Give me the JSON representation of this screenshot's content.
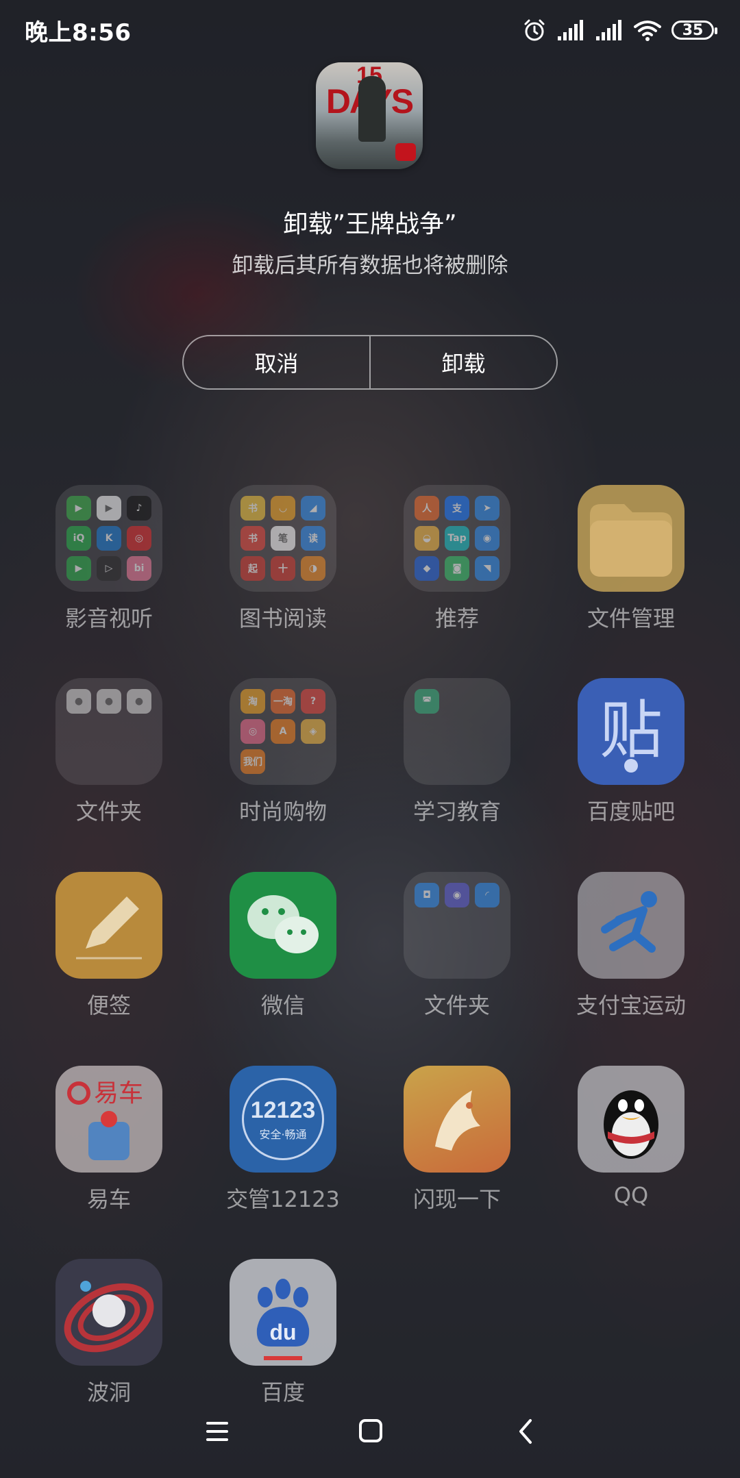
{
  "status_bar": {
    "time": "晚上8:56",
    "battery": "35",
    "icons": [
      "alarm-icon",
      "signal-icon-sim1",
      "signal-icon-sim2",
      "wifi-icon",
      "battery-icon"
    ]
  },
  "dialog": {
    "app_icon_text_top": "15",
    "app_icon_text": "DAYS",
    "title": "卸载”王牌战争”",
    "subtitle": "卸载后其所有数据也将被删除",
    "cancel_label": "取消",
    "uninstall_label": "卸载"
  },
  "apps": [
    {
      "label": "影音视听",
      "type": "folder",
      "minis": [
        {
          "icon": "play-store-icon",
          "color": "#3bb34a",
          "text": "▶"
        },
        {
          "icon": "video-icon",
          "color": "#ffffff",
          "text": "▶"
        },
        {
          "icon": "douyin-icon",
          "color": "#111111",
          "text": "♪"
        },
        {
          "icon": "iqiyi-icon",
          "color": "#27b34a",
          "text": "iQ"
        },
        {
          "icon": "kugou-icon",
          "color": "#1a7bd6",
          "text": "K"
        },
        {
          "icon": "netease-music-icon",
          "color": "#e02a2a",
          "text": "◎"
        },
        {
          "icon": "player-icon",
          "color": "#2bb04a",
          "text": "▶"
        },
        {
          "icon": "tencent-video-icon",
          "color": "#2b2b2b",
          "text": "▷"
        },
        {
          "icon": "bilibili-icon",
          "color": "#f07a9b",
          "text": "bi"
        }
      ]
    },
    {
      "label": "图书阅读",
      "type": "folder",
      "minis": [
        {
          "icon": "novel-icon",
          "color": "#f3c53b",
          "text": "书"
        },
        {
          "icon": "reader-icon",
          "color": "#f5a623",
          "text": "◡"
        },
        {
          "icon": "read-icon",
          "color": "#2d8cf0",
          "text": "◢"
        },
        {
          "icon": "book-icon",
          "color": "#e8453c",
          "text": "书"
        },
        {
          "icon": "pen-icon",
          "color": "#ffffff",
          "text": "笔"
        },
        {
          "icon": "qq-read-icon",
          "color": "#2d8cf0",
          "text": "读"
        },
        {
          "icon": "qidian-icon",
          "color": "#d33a31",
          "text": "起"
        },
        {
          "icon": "text-icon",
          "color": "#d33a31",
          "text": "十"
        },
        {
          "icon": "audio-book-icon",
          "color": "#f08a24",
          "text": "◑"
        }
      ]
    },
    {
      "label": "推荐",
      "type": "folder",
      "minis": [
        {
          "icon": "sports-icon",
          "color": "#f06a2b",
          "text": "人"
        },
        {
          "icon": "alipay-icon",
          "color": "#1677ff",
          "text": "支"
        },
        {
          "icon": "paper-plane-icon",
          "color": "#2d8cf0",
          "text": "➤"
        },
        {
          "icon": "photo-icon",
          "color": "#f5b942",
          "text": "◒"
        },
        {
          "icon": "taptap-icon",
          "color": "#16c1c8",
          "text": "Tap"
        },
        {
          "icon": "mobile-icon",
          "color": "#2d8cf0",
          "text": "◉"
        },
        {
          "icon": "app-icon",
          "color": "#1f63e0",
          "text": "◆"
        },
        {
          "icon": "shield-icon",
          "color": "#36c46b",
          "text": "◙"
        },
        {
          "icon": "send-icon",
          "color": "#2d8cf0",
          "text": "◥"
        }
      ]
    },
    {
      "label": "文件管理",
      "type": "file-manager"
    },
    {
      "label": "文件夹",
      "type": "folder",
      "minis": [
        {
          "icon": "contact-icon",
          "color": "#d8d8d8",
          "text": "●"
        },
        {
          "icon": "contact-icon",
          "color": "#d8d8d8",
          "text": "●"
        },
        {
          "icon": "contact-icon",
          "color": "#d8d8d8",
          "text": "●"
        }
      ]
    },
    {
      "label": "时尚购物",
      "type": "folder",
      "minis": [
        {
          "icon": "taobao-icon",
          "color": "#f5a623",
          "text": "淘"
        },
        {
          "icon": "yitao-icon",
          "color": "#f06a2b",
          "text": "一淘"
        },
        {
          "icon": "question-icon",
          "color": "#e8453c",
          "text": "?"
        },
        {
          "icon": "game-icon",
          "color": "#f06a8b",
          "text": "◎"
        },
        {
          "icon": "alibaba-icon",
          "color": "#f5801f",
          "text": "A"
        },
        {
          "icon": "voucher-icon",
          "color": "#f5b942",
          "text": "◈"
        },
        {
          "icon": "shop-icon",
          "color": "#f5801f",
          "text": "我们"
        }
      ]
    },
    {
      "label": "学习教育",
      "type": "folder",
      "minis": [
        {
          "icon": "study-icon",
          "color": "#36b37e",
          "text": "◚"
        }
      ]
    },
    {
      "label": "百度贴吧",
      "type": "tieba"
    },
    {
      "label": "便签",
      "type": "notes"
    },
    {
      "label": "微信",
      "type": "wechat"
    },
    {
      "label": "文件夹",
      "type": "folder",
      "minis": [
        {
          "icon": "gamepad-icon",
          "color": "#2d8cf0",
          "text": "◘"
        },
        {
          "icon": "face-icon",
          "color": "#5b5bd6",
          "text": "◉"
        },
        {
          "icon": "wave-icon",
          "color": "#2d8cf0",
          "text": "◜"
        }
      ]
    },
    {
      "label": "支付宝运动",
      "type": "alipay-sport"
    },
    {
      "label": "易车",
      "type": "yiche"
    },
    {
      "label": "交管12123",
      "type": "traffic",
      "tile_text": "12123",
      "tile_subtext": "安全·畅通"
    },
    {
      "label": "闪现一下",
      "type": "flash"
    },
    {
      "label": "QQ",
      "type": "qq"
    },
    {
      "label": "波洞",
      "type": "bodong"
    },
    {
      "label": "百度",
      "type": "baidu",
      "tile_text": "du"
    }
  ],
  "nav_bar": {
    "menu": "menu-icon",
    "home": "home-icon",
    "back": "back-icon"
  }
}
